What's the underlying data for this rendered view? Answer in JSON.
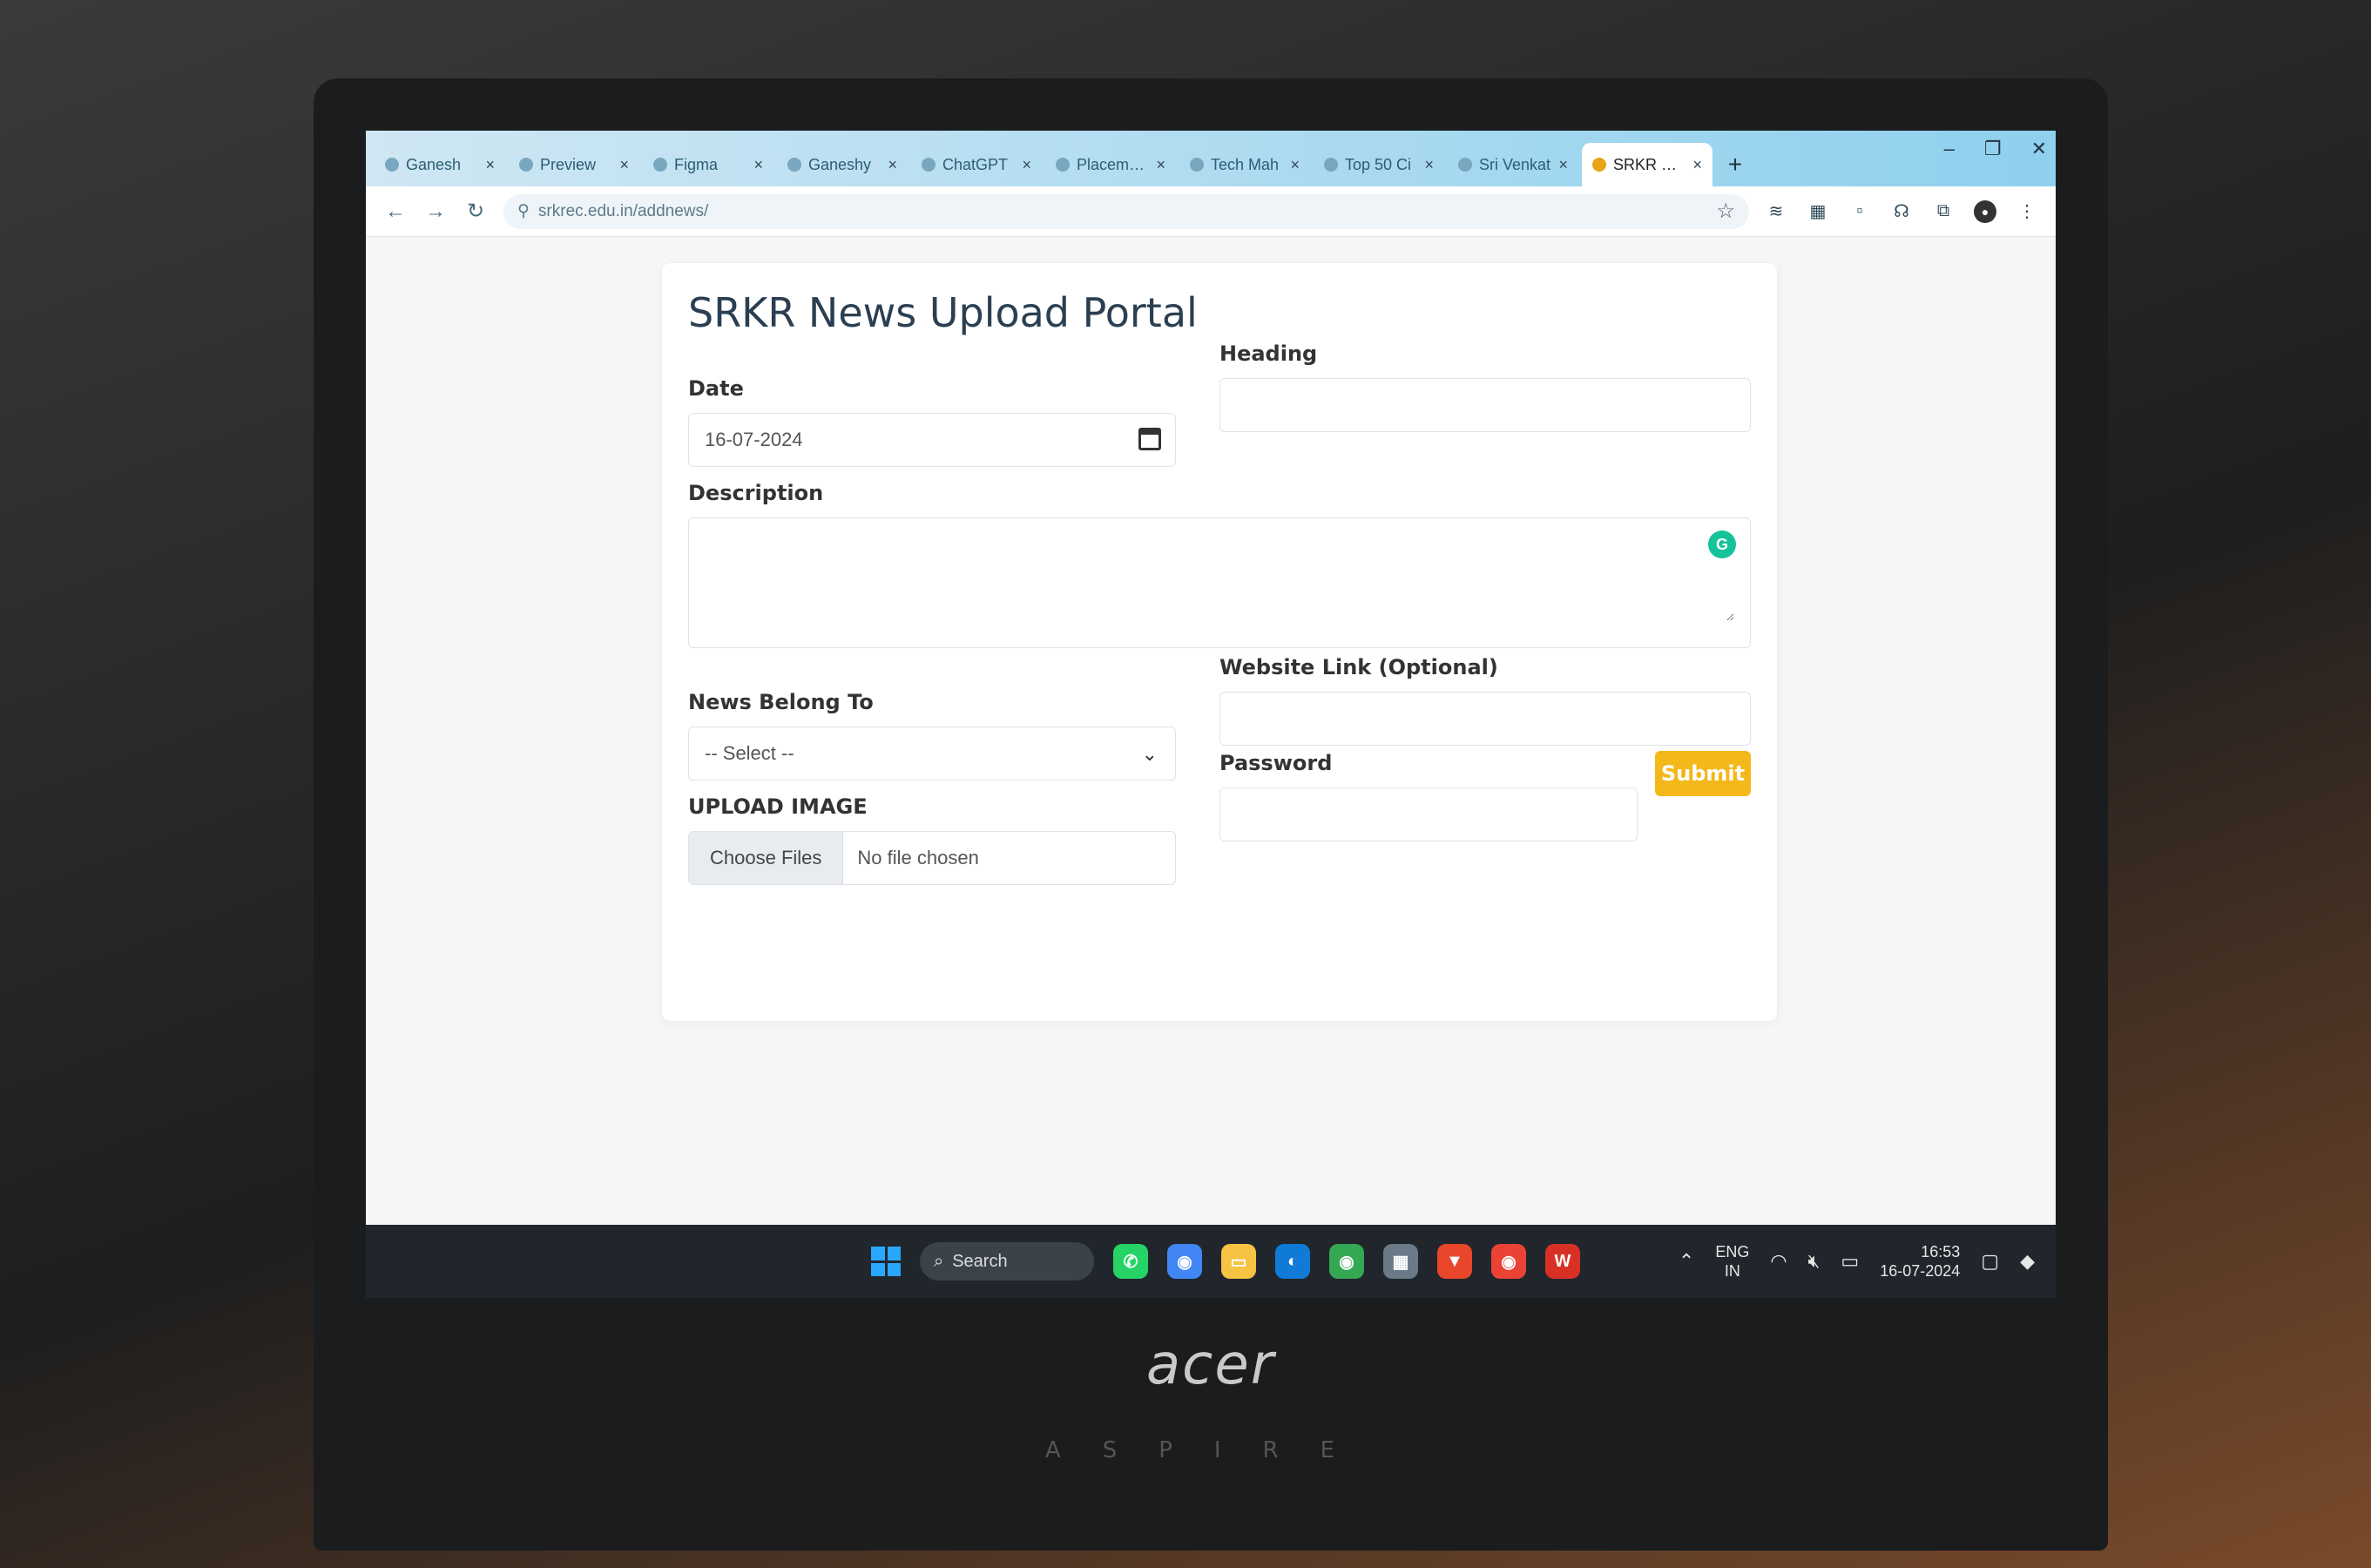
{
  "browser": {
    "tabs": [
      {
        "label": "Ganesh"
      },
      {
        "label": "Preview"
      },
      {
        "label": "Figma"
      },
      {
        "label": "Ganeshy"
      },
      {
        "label": "ChatGPT"
      },
      {
        "label": "Placement"
      },
      {
        "label": "Tech Mah"
      },
      {
        "label": "Top 50 Ci"
      },
      {
        "label": "Sri Venkat"
      },
      {
        "label": "SRKR New"
      }
    ],
    "url": "srkrec.edu.in/addnews/"
  },
  "form": {
    "title": "SRKR News Upload Portal",
    "date_label": "Date",
    "date_value": "16-07-2024",
    "heading_label": "Heading",
    "description_label": "Description",
    "website_label": "Website Link (Optional)",
    "news_belong_label": "News Belong To",
    "news_belong_value": "-- Select --",
    "password_label": "Password",
    "upload_label": "UPLOAD IMAGE",
    "choose_files": "Choose Files",
    "no_file": "No file chosen",
    "submit_label": "Submit"
  },
  "taskbar": {
    "search_label": "Search",
    "lang_top": "ENG",
    "lang_bottom": "IN",
    "time": "16:53",
    "date": "16-07-2024"
  },
  "device": {
    "brand": "acer",
    "model": "ASPIRE"
  },
  "colors": {
    "submit": "#f4b81a",
    "tabbar": "#8fd0ee",
    "title": "#2b3f52"
  }
}
